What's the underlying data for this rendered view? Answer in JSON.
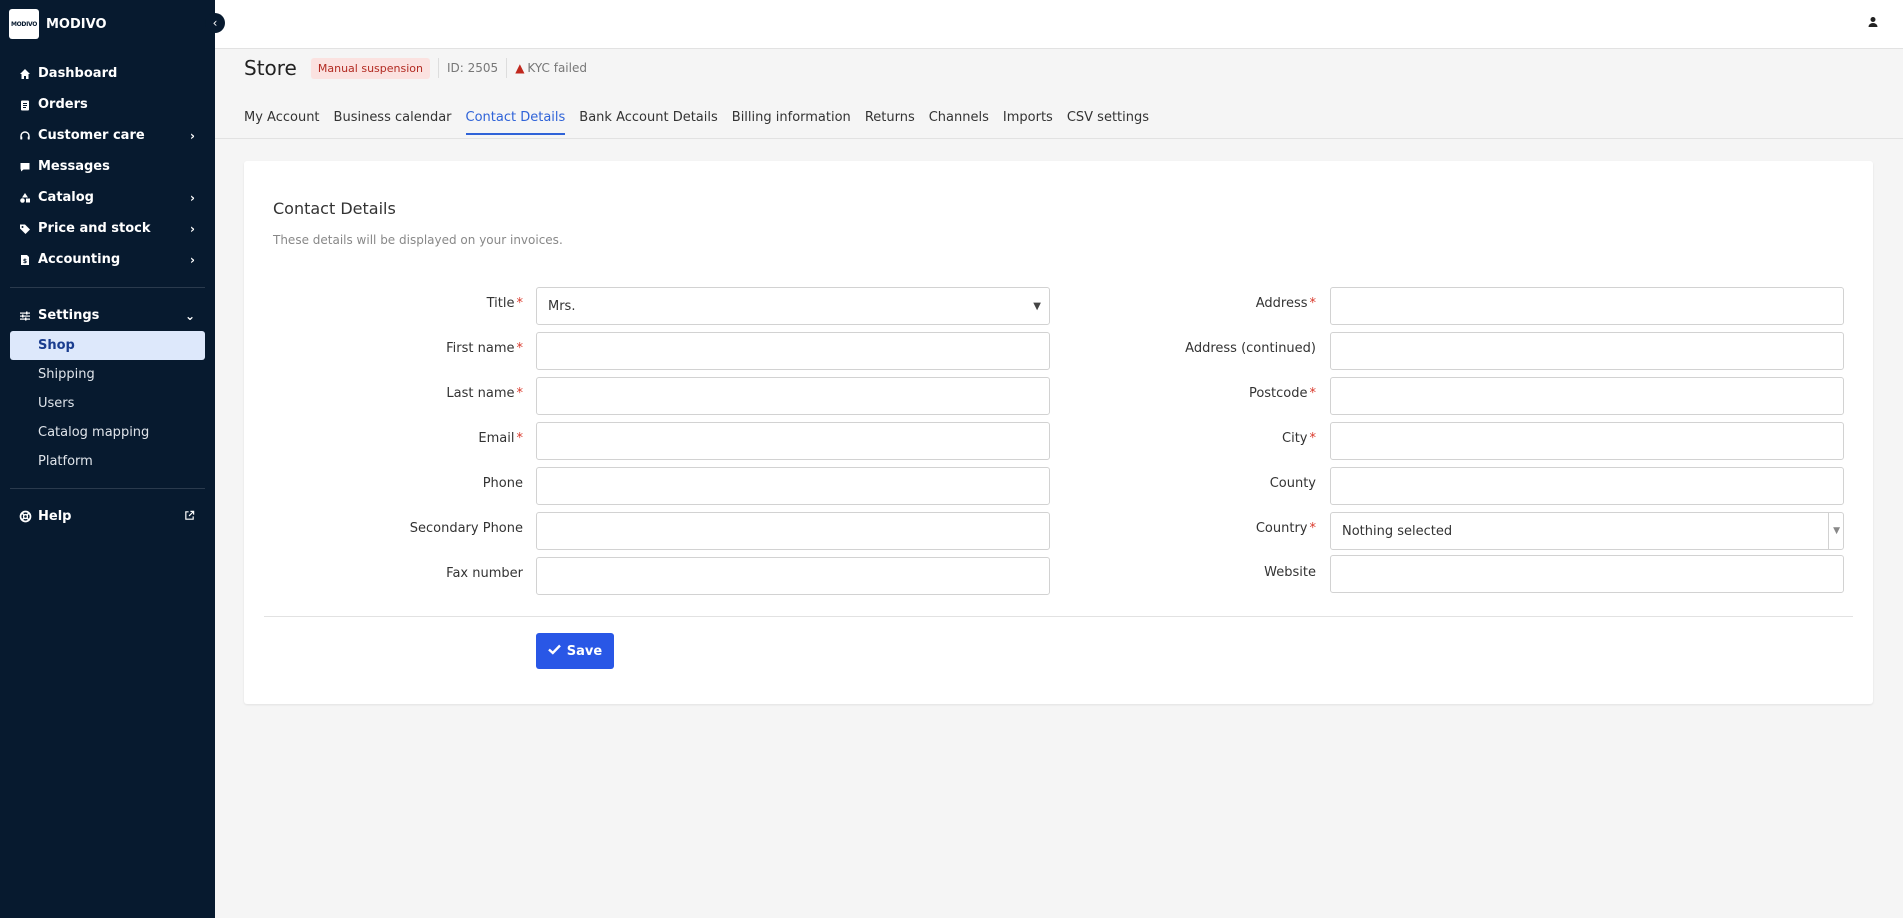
{
  "brand": {
    "logo_text": "MODIVO",
    "name": "MODIVO"
  },
  "sidebar": {
    "items": [
      {
        "label": "Dashboard",
        "icon": "home-icon",
        "has_chevron": false
      },
      {
        "label": "Orders",
        "icon": "clipboard-icon",
        "has_chevron": false
      },
      {
        "label": "Customer care",
        "icon": "headset-icon",
        "has_chevron": true
      },
      {
        "label": "Messages",
        "icon": "chat-icon",
        "has_chevron": false
      },
      {
        "label": "Catalog",
        "icon": "shapes-icon",
        "has_chevron": true
      },
      {
        "label": "Price and stock",
        "icon": "tag-icon",
        "has_chevron": true
      },
      {
        "label": "Accounting",
        "icon": "invoice-icon",
        "has_chevron": true
      }
    ],
    "settings": {
      "label": "Settings",
      "icon": "sliders-icon"
    },
    "settings_sub": [
      "Shop",
      "Shipping",
      "Users",
      "Catalog mapping",
      "Platform"
    ],
    "settings_active": "Shop",
    "help": {
      "label": "Help",
      "icon": "lifebuoy-icon"
    }
  },
  "header": {
    "title": "Store",
    "status_badge": "Manual suspension",
    "id_text": "ID: 2505",
    "kyc_text": "KYC failed"
  },
  "tabs": [
    "My Account",
    "Business calendar",
    "Contact Details",
    "Bank Account Details",
    "Billing information",
    "Returns",
    "Channels",
    "Imports",
    "CSV settings"
  ],
  "active_tab": "Contact Details",
  "form": {
    "title": "Contact Details",
    "subtitle": "These details will be displayed on your invoices.",
    "left": [
      {
        "label": "Title",
        "required": true,
        "value": "Mrs.",
        "type": "select"
      },
      {
        "label": "First name",
        "required": true,
        "value": "",
        "type": "text"
      },
      {
        "label": "Last name",
        "required": true,
        "value": "",
        "type": "text"
      },
      {
        "label": "Email",
        "required": true,
        "value": "",
        "type": "text"
      },
      {
        "label": "Phone",
        "required": false,
        "value": "",
        "type": "text"
      },
      {
        "label": "Secondary Phone",
        "required": false,
        "value": "",
        "type": "text"
      },
      {
        "label": "Fax number",
        "required": false,
        "value": "",
        "type": "text"
      }
    ],
    "right": [
      {
        "label": "Address",
        "required": true,
        "value": "",
        "type": "text"
      },
      {
        "label": "Address (continued)",
        "required": false,
        "value": "",
        "type": "text"
      },
      {
        "label": "Postcode",
        "required": true,
        "value": "",
        "type": "text"
      },
      {
        "label": "City",
        "required": true,
        "value": "",
        "type": "text"
      },
      {
        "label": "County",
        "required": false,
        "value": "",
        "type": "text"
      },
      {
        "label": "Country",
        "required": true,
        "value": "Nothing selected",
        "type": "select"
      },
      {
        "label": "Website",
        "required": false,
        "value": "",
        "type": "text"
      }
    ],
    "save_label": "Save"
  },
  "colors": {
    "sidebar_bg": "#071a2f",
    "accent": "#2957e6",
    "active_tab": "#2f63d8",
    "required": "#d9382a",
    "badge_bg": "#fbe2e0",
    "badge_text": "#b22b22"
  }
}
